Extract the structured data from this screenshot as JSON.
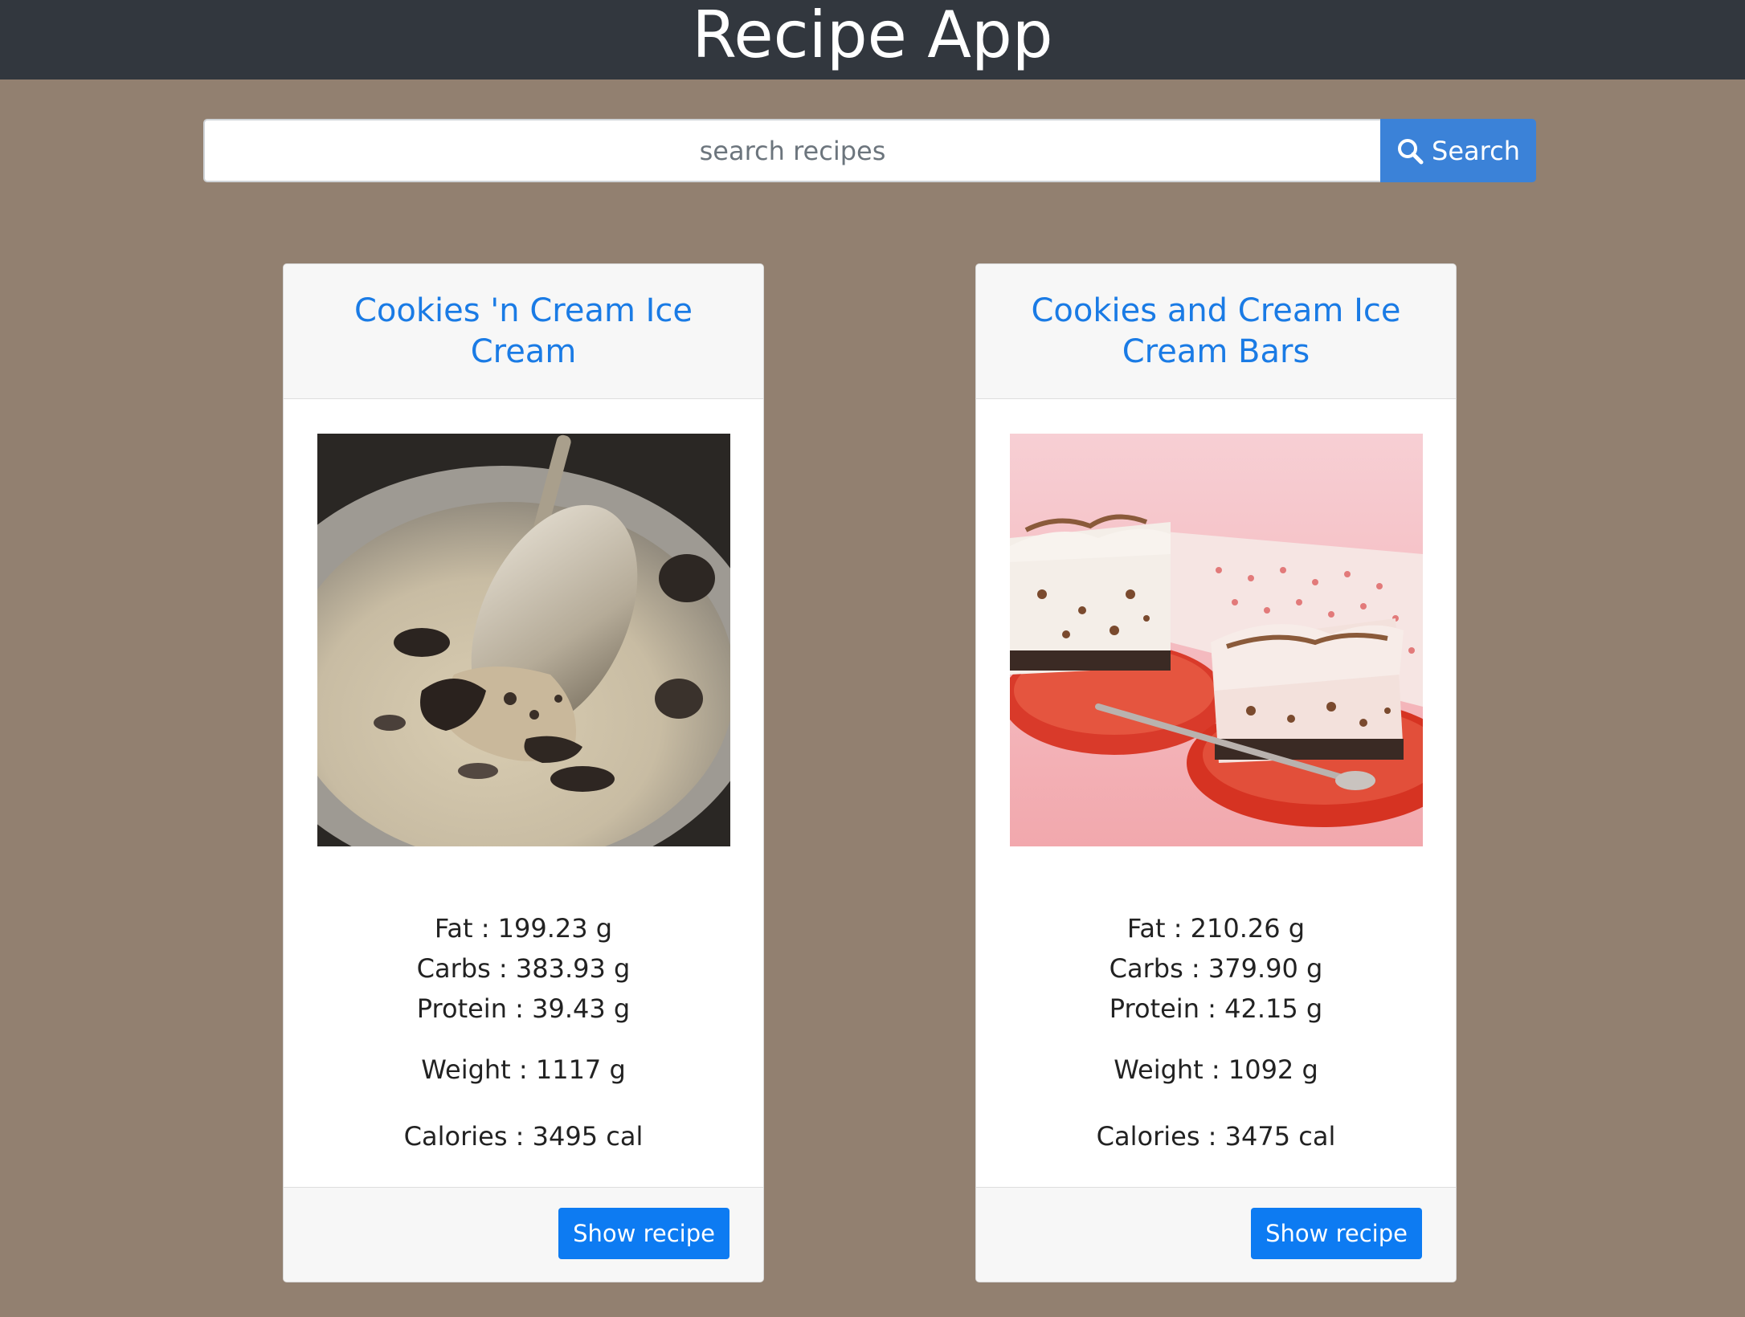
{
  "header": {
    "title": "Recipe App"
  },
  "search": {
    "placeholder": "search recipes",
    "value": "",
    "button_label": "Search",
    "button_icon": "search-icon"
  },
  "colors": {
    "header_bg": "#32373e",
    "page_bg": "#928070",
    "accent": "#0d7bf2",
    "title_link": "#1a7be5"
  },
  "recipes": [
    {
      "title": "Cookies 'n Cream Ice Cream",
      "image": "cookies-n-cream-ice-cream-photo",
      "fat": "Fat : 199.23 g",
      "carbs": "Carbs : 383.93 g",
      "protein": "Protein : 39.43 g",
      "weight": "Weight : 1117 g",
      "calories": "Calories : 3495 cal",
      "button_label": "Show recipe"
    },
    {
      "title": "Cookies and Cream Ice Cream Bars",
      "image": "cookies-and-cream-ice-cream-bars-photo",
      "fat": "Fat : 210.26 g",
      "carbs": "Carbs : 379.90 g",
      "protein": "Protein : 42.15 g",
      "weight": "Weight : 1092 g",
      "calories": "Calories : 3475 cal",
      "button_label": "Show recipe"
    }
  ]
}
